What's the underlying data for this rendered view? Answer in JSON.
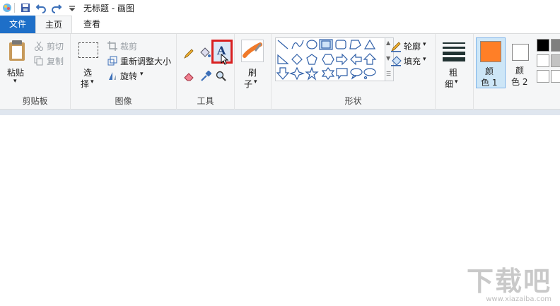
{
  "window": {
    "title": "无标题 - 画图"
  },
  "tabs": {
    "file": "文件",
    "home": "主页",
    "view": "查看"
  },
  "clipboard": {
    "paste": "粘贴",
    "cut": "剪切",
    "copy": "复制",
    "group": "剪贴板"
  },
  "image": {
    "select_1": "选",
    "select_2": "择",
    "crop": "裁剪",
    "resize": "重新调整大小",
    "rotate": "旋转",
    "group": "图像"
  },
  "tools": {
    "group": "工具"
  },
  "brushes": {
    "label_1": "刷",
    "label_2": "子"
  },
  "shapes": {
    "outline": "轮廓",
    "fill": "填充",
    "group": "形状"
  },
  "size": {
    "label_1": "粗",
    "label_2": "细"
  },
  "colors": {
    "color1_1": "颜",
    "color1_2": "色 1",
    "color2_1": "颜",
    "color2_2": "色 2",
    "color1_hex": "#ff7f27",
    "color2_hex": "#ffffff",
    "accent": "#1e6fc8",
    "highlight": "#d92020"
  },
  "watermark": {
    "text": "下载吧",
    "url": "www.xiazaiba.com"
  }
}
